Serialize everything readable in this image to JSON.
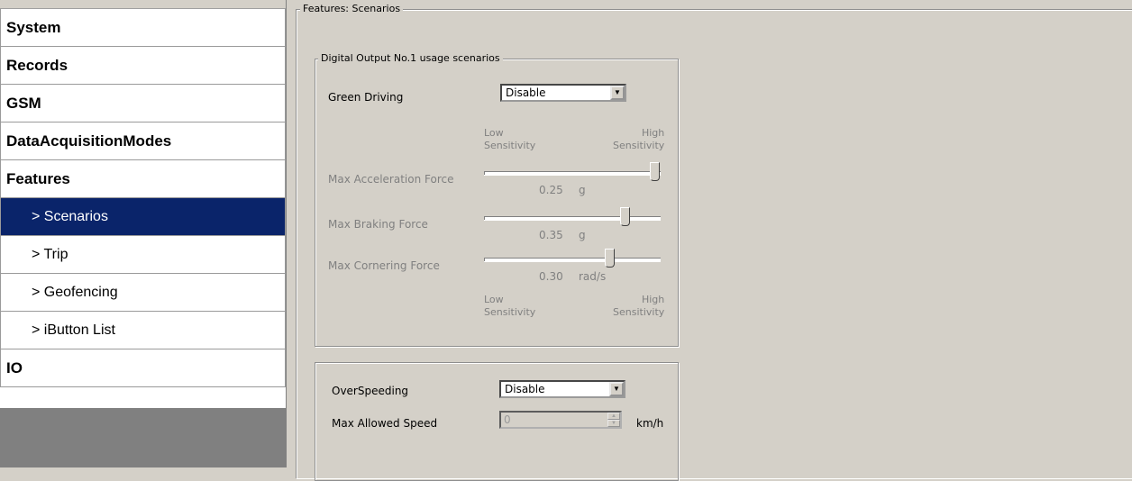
{
  "sidebar": {
    "items": [
      {
        "label": "System"
      },
      {
        "label": "Records"
      },
      {
        "label": "GSM"
      },
      {
        "label": "DataAcquisitionModes"
      },
      {
        "label": "Features"
      },
      {
        "label": "> Scenarios"
      },
      {
        "label": "> Trip"
      },
      {
        "label": "> Geofencing"
      },
      {
        "label": "> iButton List"
      },
      {
        "label": "IO"
      }
    ],
    "active_index": 5
  },
  "panel": {
    "outer_legend": "Features: Scenarios",
    "digital_output": {
      "legend": "Digital Output No.1 usage scenarios",
      "green_driving": {
        "label": "Green Driving",
        "value": "Disable"
      },
      "sensitivity_top": {
        "low": "Low",
        "low2": "Sensitivity",
        "high": "High",
        "high2": "Sensitivity"
      },
      "sliders": [
        {
          "label": "Max Acceleration Force",
          "value": "0.25",
          "unit": "g",
          "position": 1.0
        },
        {
          "label": "Max Braking Force",
          "value": "0.35",
          "unit": "g",
          "position": 0.82
        },
        {
          "label": "Max Cornering Force",
          "value": "0.30",
          "unit": "rad/s",
          "position": 0.73
        }
      ],
      "sensitivity_bottom": {
        "low": "Low",
        "low2": "Sensitivity",
        "high": "High",
        "high2": "Sensitivity"
      }
    },
    "overspeeding": {
      "label": "OverSpeeding",
      "value": "Disable",
      "max_speed_label": "Max Allowed Speed",
      "max_speed_value": "0",
      "max_speed_unit": "km/h"
    }
  },
  "colors": {
    "window_bg": "#d4d0c8",
    "selected_bg": "#0a246a",
    "disabled_text": "#808080"
  }
}
